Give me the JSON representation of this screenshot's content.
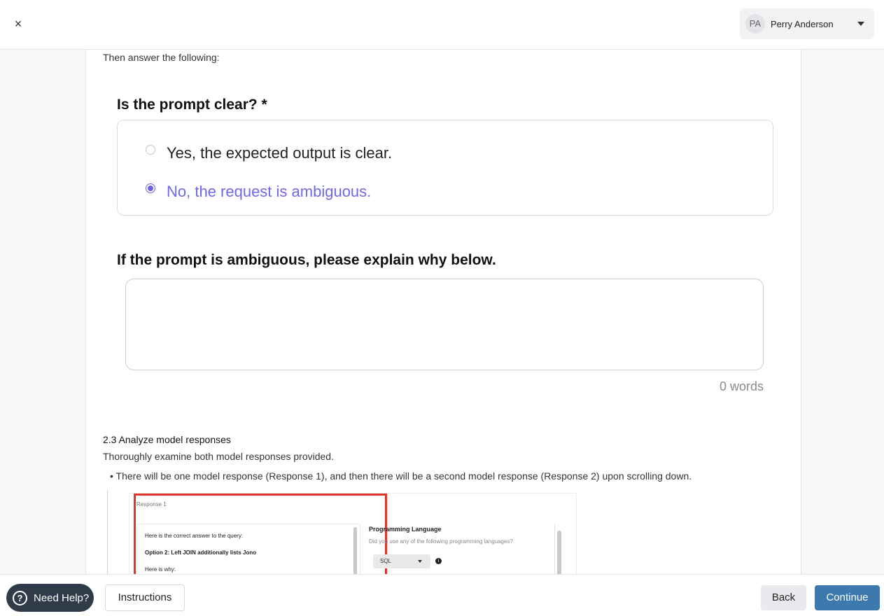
{
  "topbar": {
    "close_glyph": "×",
    "user": {
      "initials": "PA",
      "name": "Perry Anderson"
    }
  },
  "content": {
    "intro": "Then answer the following:",
    "question1": {
      "title": "Is the prompt clear? *",
      "options": [
        {
          "label": "Yes, the expected output is clear.",
          "selected": false
        },
        {
          "label": "No, the request is ambiguous.",
          "selected": true
        }
      ]
    },
    "question2": {
      "title": "If the prompt is ambiguous, please explain why below.",
      "value": "",
      "word_count": "0 words"
    },
    "section": {
      "title": "2.3 Analyze model responses",
      "description": "Thoroughly examine both model responses provided.",
      "bullet": "• There will be one model response (Response 1), and then there will be a second model response (Response 2) upon scrolling down."
    },
    "screenshot": {
      "response_label": "Response 1",
      "line1": "Here is the correct answer to the query:",
      "line2": "Option 2: Left JOIN additionally lists Jono",
      "line3": "Here is why:",
      "pl_title": "Programming Language",
      "pl_desc": "Did you use any of the following programming languages?",
      "pl_select": "SQL",
      "info_glyph": "i"
    }
  },
  "bottombar": {
    "help_icon_glyph": "?",
    "help_label": "Need Help?",
    "instructions_label": "Instructions",
    "back_label": "Back",
    "continue_label": "Continue"
  },
  "colors": {
    "accent": "#7267e8",
    "continue": "#3d79ad",
    "help_bg": "#2f3b48",
    "highlight_frame": "#e0352b"
  }
}
